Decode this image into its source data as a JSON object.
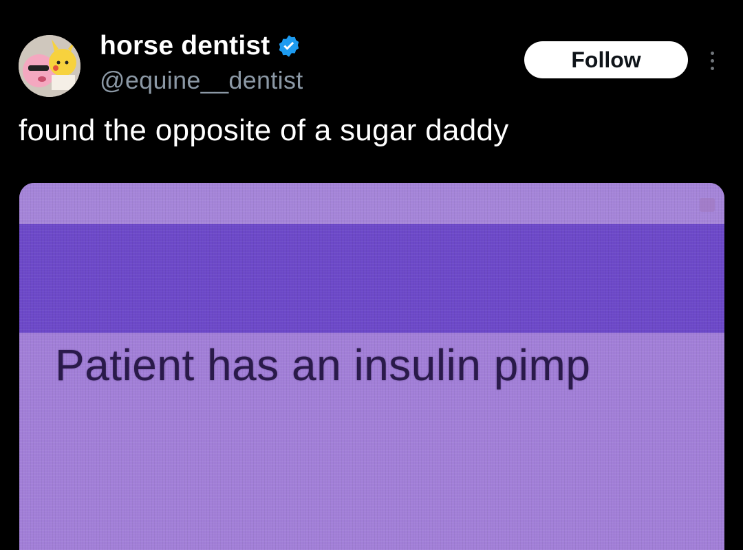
{
  "author": {
    "display_name": "horse dentist",
    "handle": "@equine__dentist",
    "verified": true,
    "verified_color": "#1d9bf0"
  },
  "actions": {
    "follow_label": "Follow",
    "more_icon": "more-vertical-icon"
  },
  "tweet": {
    "text": "found the opposite of a sugar daddy"
  },
  "media": {
    "caption": "Patient has an insulin pimp",
    "colors": {
      "top_band": "#a585d9",
      "header_band": "#6d49c9",
      "body": "#a27fd8"
    }
  }
}
